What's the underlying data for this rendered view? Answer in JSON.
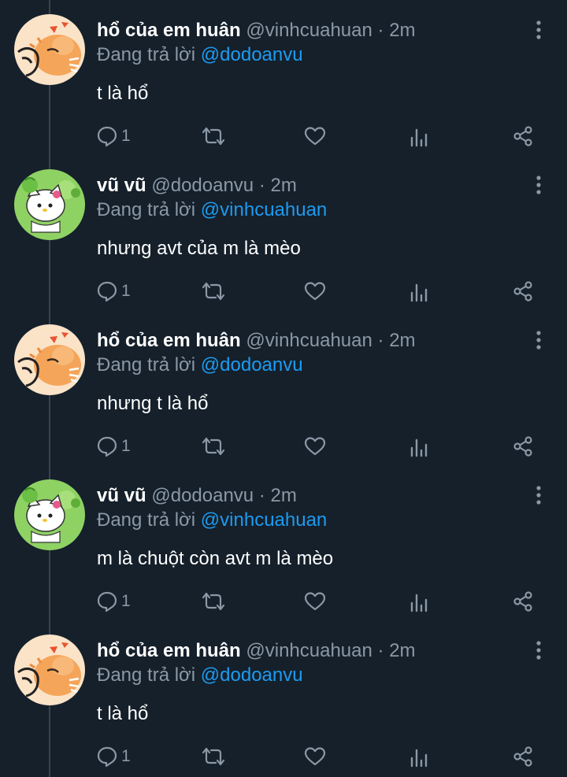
{
  "colors": {
    "background": "#15202b",
    "thread_line": "#38444d",
    "name": "#ffffff",
    "muted": "#8b98a5",
    "mention": "#1d9bf0"
  },
  "tweets": [
    {
      "display_name": "hổ của em huân",
      "handle": "@vinhcuahuan",
      "time": "· 2m",
      "replying_prefix": "Đang trả lời",
      "replying_to": "@dodoanvu",
      "text": "t là hổ",
      "reply_count": "1",
      "avatar": "tiger-avatar"
    },
    {
      "display_name": "vũ vũ",
      "handle": "@dodoanvu",
      "time": "· 2m",
      "replying_prefix": "Đang trả lời",
      "replying_to": "@vinhcuahuan",
      "text": "nhưng avt của m là mèo",
      "reply_count": "1",
      "avatar": "kitty-peashooter-avatar"
    },
    {
      "display_name": "hổ của em huân",
      "handle": "@vinhcuahuan",
      "time": "· 2m",
      "replying_prefix": "Đang trả lời",
      "replying_to": "@dodoanvu",
      "text": "nhưng t là hổ",
      "reply_count": "1",
      "avatar": "tiger-avatar"
    },
    {
      "display_name": "vũ vũ",
      "handle": "@dodoanvu",
      "time": "· 2m",
      "replying_prefix": "Đang trả lời",
      "replying_to": "@vinhcuahuan",
      "text": "m là chuột còn avt m là mèo",
      "reply_count": "1",
      "avatar": "kitty-peashooter-avatar"
    },
    {
      "display_name": "hổ của em huân",
      "handle": "@vinhcuahuan",
      "time": "· 2m",
      "replying_prefix": "Đang trả lời",
      "replying_to": "@dodoanvu",
      "text": "t là hổ",
      "reply_count": "1",
      "avatar": "tiger-avatar"
    }
  ],
  "icons": {
    "reply": "reply-icon",
    "retweet": "retweet-icon",
    "like": "like-icon",
    "analytics": "analytics-icon",
    "share": "share-icon",
    "more": "more-options-icon"
  }
}
